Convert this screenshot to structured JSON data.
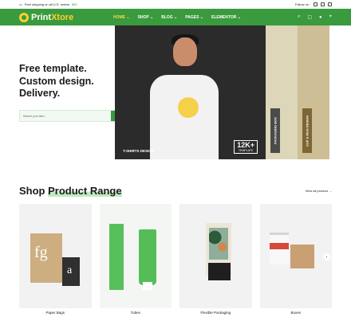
{
  "topbar": {
    "shipping_text": "Free shipping on all U.S. orders",
    "shipping_amount": "$50",
    "follow_label": "Follow us :"
  },
  "nav": {
    "logo_primary": "Print",
    "logo_secondary": "Xtore",
    "items": [
      "HOME ⌄",
      "SHOP ⌄",
      "BLOG ⌄",
      "PAGES ⌄",
      "ELEMENTOR ⌄"
    ],
    "cart_count": "0"
  },
  "hero": {
    "title_line1": "Free template.",
    "title_line2": "Custom design.",
    "title_line3": "Delivery.",
    "search_placeholder": "Search your item...",
    "image_caption": "T-SHIRTS DESIGN",
    "stat_value": "12K+",
    "stat_label": "TEMPLATE",
    "panel1_label": "PACKAGING BOX",
    "panel2_label": "CUP & MUG DESIGN"
  },
  "products": {
    "title_prefix": "Shop",
    "title_highlight": "Product Range",
    "view_all": "View all product",
    "items": [
      {
        "label": "Paper Bags"
      },
      {
        "label": "Tubes"
      },
      {
        "label": "Flexible Packaging"
      },
      {
        "label": "Boxes"
      }
    ]
  },
  "colors": {
    "brand_green": "#3a9a3e",
    "accent_yellow": "#ffcf2d"
  },
  "icons": [
    "search-icon",
    "cart-icon",
    "user-icon",
    "location-icon",
    "arrow-right-icon"
  ]
}
